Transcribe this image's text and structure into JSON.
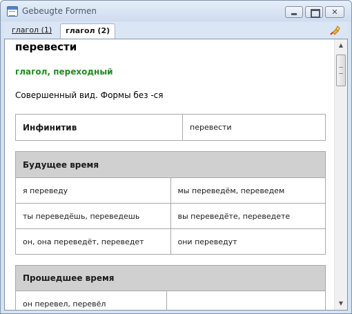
{
  "window": {
    "title": "Gebeugte Formen"
  },
  "tabs": [
    {
      "label": "глагол (1)",
      "active": false
    },
    {
      "label": "глагол (2)",
      "active": true
    }
  ],
  "icons": {
    "app": "app-window-icon",
    "pin": "pin-icon",
    "minimize": "minimize-icon",
    "maximize": "maximize-icon",
    "close": "close-icon"
  },
  "entry": {
    "word": "перевести",
    "part_of_speech": "глагол, переходный",
    "aspect_note": "Совершенный вид. Формы без -ся",
    "infinitive_label": "Инфинитив",
    "infinitive_value": "перевести"
  },
  "future": {
    "header": "Будущее время",
    "rows": [
      [
        "я переведу",
        "мы переведём, переведем"
      ],
      [
        "ты переведёшь, переведешь",
        "вы переведёте, переведете"
      ],
      [
        "он, она переведёт, переведет",
        "они переведут"
      ]
    ]
  },
  "past": {
    "header": "Прошедшее время",
    "rows": [
      [
        "он перевел, перевёл",
        ""
      ]
    ]
  },
  "colors": {
    "part_of_speech": "#228b22",
    "table_header_bg": "#d0d0d0",
    "window_frame": "#d6e3f3"
  }
}
